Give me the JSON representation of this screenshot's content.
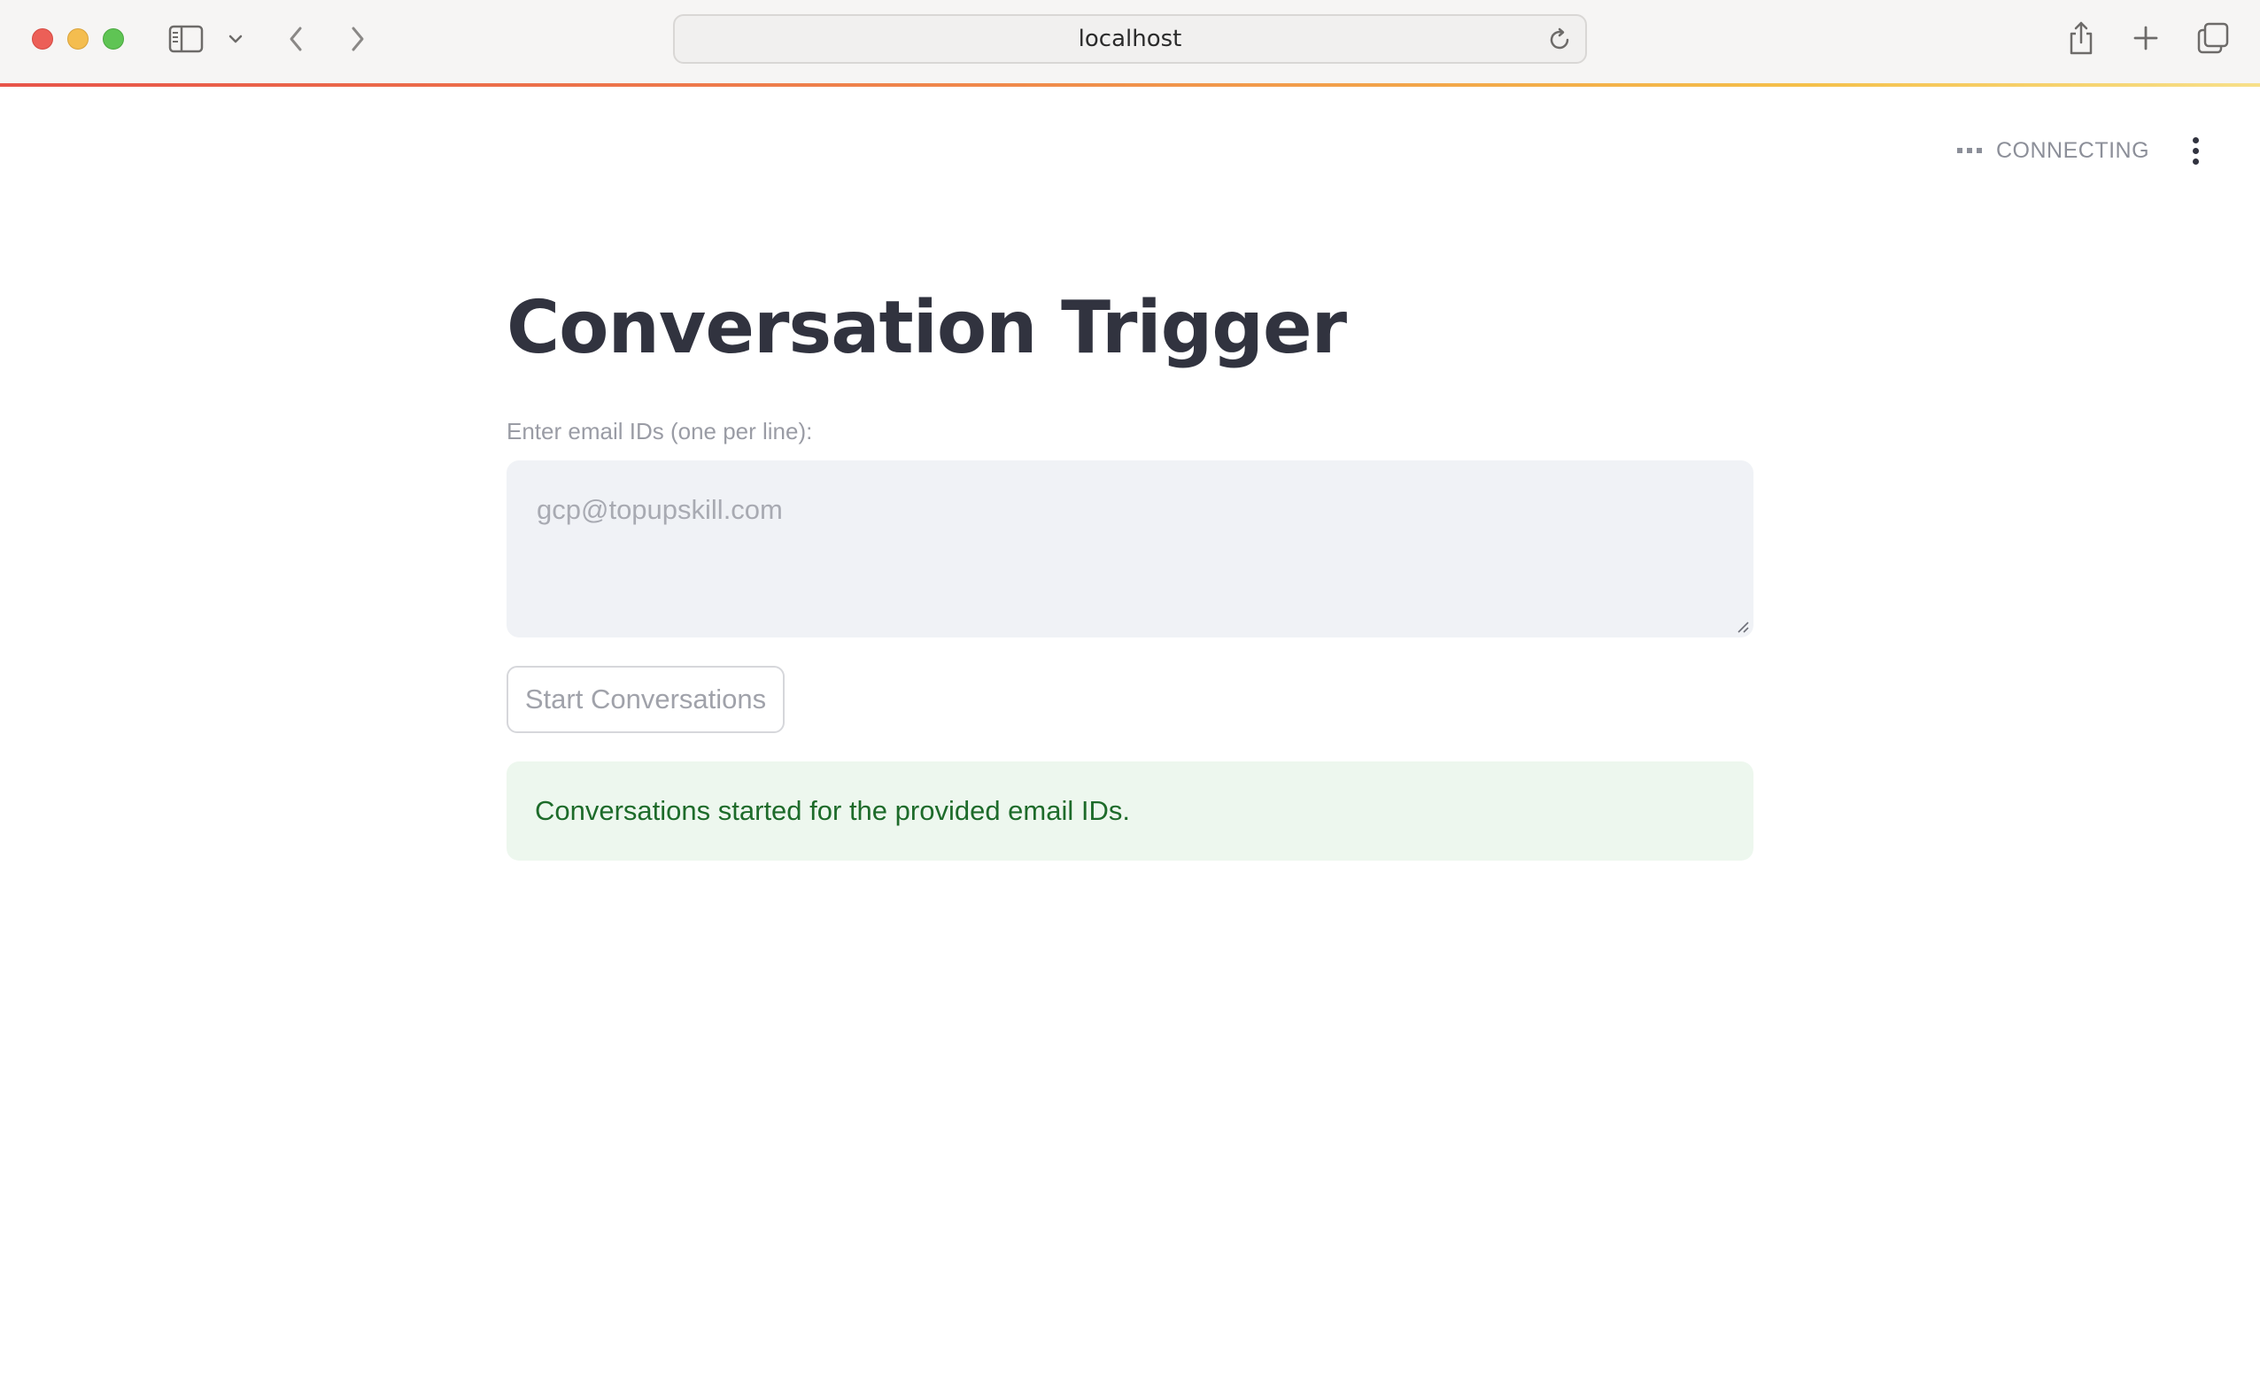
{
  "browser": {
    "url": "localhost",
    "icons": {
      "sidebar": "sidebar-icon",
      "dropdown": "chevron-down-icon",
      "back": "chevron-left-icon",
      "forward": "chevron-right-icon",
      "reload": "reload-icon",
      "share": "share-icon",
      "new_tab": "plus-icon",
      "tabs": "tabs-overview-icon"
    },
    "accent_gradient": [
      "#e8544a",
      "#f08a4b",
      "#f5c04a",
      "#f7e08a"
    ]
  },
  "app": {
    "status": "CONNECTING",
    "title": "Conversation Trigger",
    "email_field": {
      "label": "Enter email IDs (one per line):",
      "placeholder": "gcp@topupskill.com",
      "value": ""
    },
    "start_button_label": "Start Conversations",
    "success_message": "Conversations started for the provided email IDs.",
    "colors": {
      "title": "#31333f",
      "success_bg": "#edf7ee",
      "success_text": "#1d6b2a",
      "input_bg": "#f0f2f6"
    }
  }
}
